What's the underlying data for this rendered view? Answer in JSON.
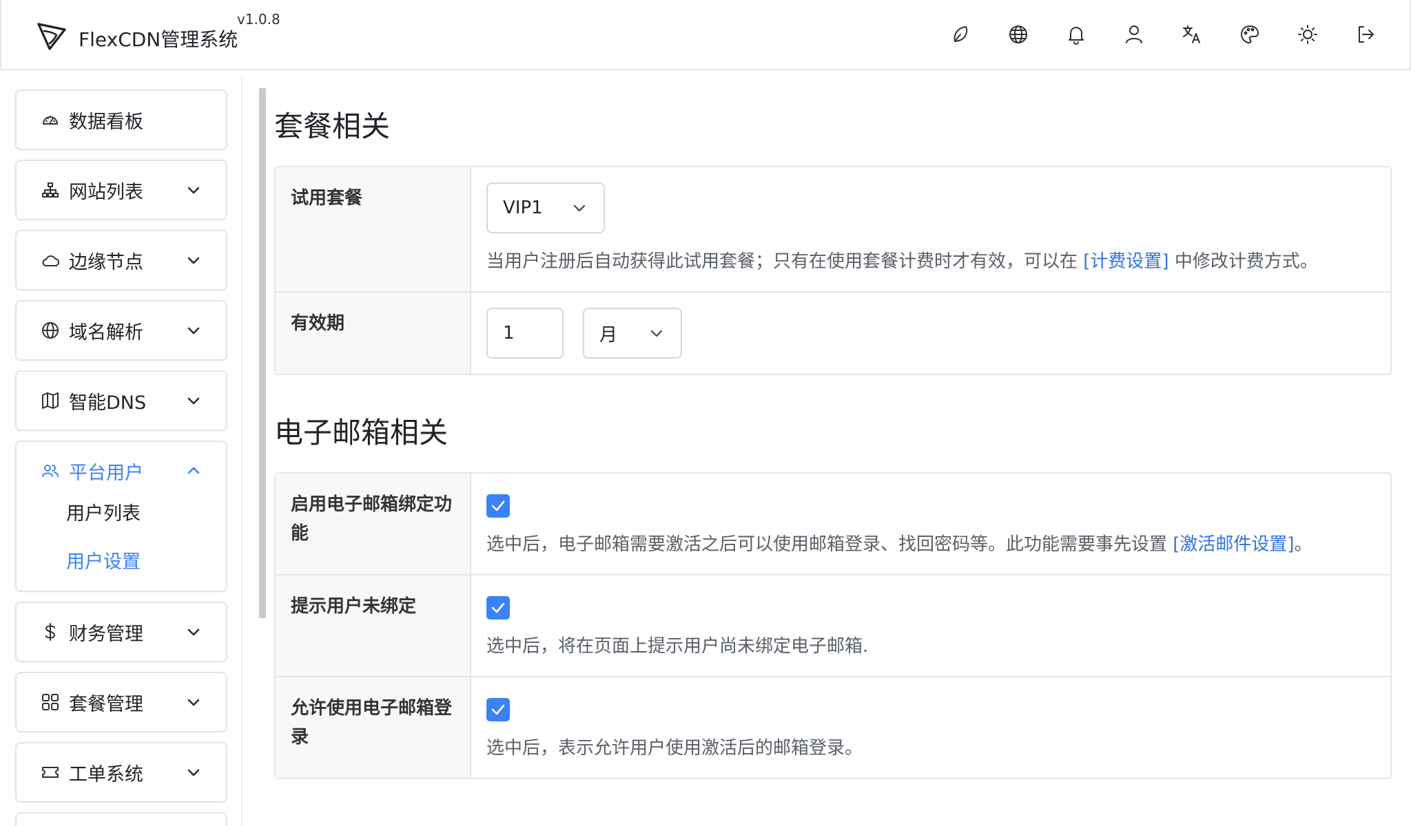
{
  "header": {
    "app_title": "FlexCDN管理系统",
    "version": "v1.0.8",
    "icons": [
      "leaf-icon",
      "globe-icon",
      "bell-icon",
      "user-icon",
      "translate-icon",
      "palette-icon",
      "sun-icon",
      "logout-icon"
    ]
  },
  "sidebar": {
    "items": [
      {
        "label": "数据看板",
        "icon": "dashboard-icon"
      },
      {
        "label": "网站列表",
        "icon": "sitemap-icon"
      },
      {
        "label": "边缘节点",
        "icon": "cloud-icon"
      },
      {
        "label": "域名解析",
        "icon": "globe-icon"
      },
      {
        "label": "智能DNS",
        "icon": "map-icon"
      },
      {
        "label": "平台用户",
        "icon": "users-icon",
        "sub": [
          "用户列表",
          "用户设置"
        ]
      },
      {
        "label": "财务管理",
        "icon": "dollar-icon"
      },
      {
        "label": "套餐管理",
        "icon": "grid-icon"
      },
      {
        "label": "工单系统",
        "icon": "ticket-icon"
      }
    ]
  },
  "sections": {
    "plan": {
      "title": "套餐相关",
      "trial_label": "试用套餐",
      "trial_value": "VIP1",
      "trial_help_before": "当用户注册后自动获得此试用套餐；只有在使用套餐计费时才有效，可以在 ",
      "trial_help_link": "[计费设置]",
      "trial_help_after": " 中修改计费方式。",
      "period_label": "有效期",
      "period_value": "1",
      "period_unit": "月"
    },
    "email": {
      "title": "电子邮箱相关",
      "bind_label": "启用电子邮箱绑定功能",
      "bind_help_before": "选中后，电子邮箱需要激活之后可以使用邮箱登录、找回密码等。此功能需要事先设置 ",
      "bind_help_link": "[激活邮件设置]",
      "bind_help_after": "。",
      "notify_label": "提示用户未绑定",
      "notify_help": "选中后，将在页面上提示用户尚未绑定电子邮箱.",
      "login_label": "允许使用电子邮箱登录",
      "login_help": "选中后，表示允许用户使用激活后的邮箱登录。"
    }
  },
  "colors": {
    "accent": "#3b82f6",
    "link": "#2f74e0"
  }
}
